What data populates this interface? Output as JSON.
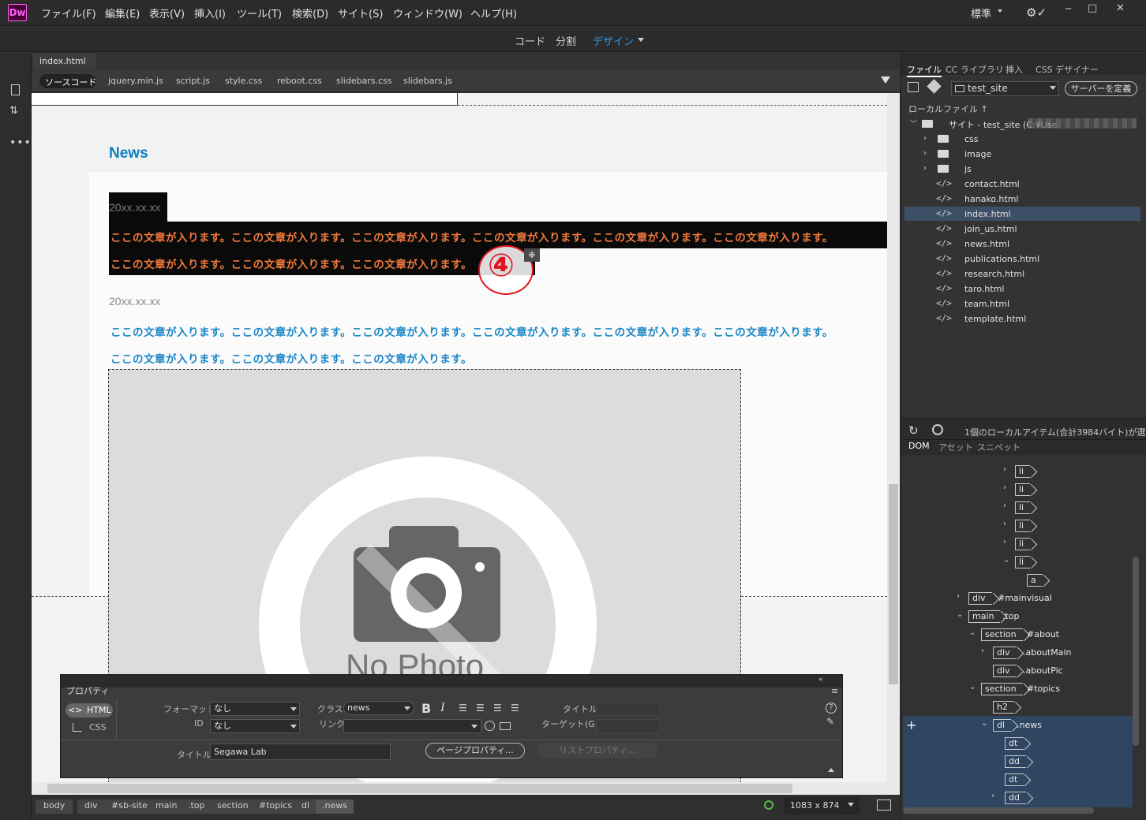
{
  "app": {
    "logo": "Dw",
    "menu": [
      "ファイル(F)",
      "編集(E)",
      "表示(V)",
      "挿入(I)",
      "ツール(T)",
      "検索(D)",
      "サイト(S)",
      "ウィンドウ(W)",
      "ヘルプ(H)"
    ],
    "workspace": "標準",
    "workspace_icon": "chevron-down-icon",
    "win_buttons": [
      "─",
      "□",
      "✕"
    ]
  },
  "views": {
    "code": "コード",
    "split": "分割",
    "design": "デザイン"
  },
  "document": {
    "tab": "index.html",
    "close": "×",
    "related": [
      "ソースコード",
      "jquery.min.js",
      "script.js",
      "style.css",
      "reboot.css",
      "slidebars.css",
      "slidebars.js"
    ]
  },
  "canvas": {
    "heading": "News",
    "item1_date": "20xx.xx.xx",
    "item1_line1": "ここの文章が入ります。ここの文章が入ります。ここの文章が入ります。ここの文章が入ります。ここの文章が入ります。ここの文章が入ります。",
    "item1_line2": "ここの文章が入ります。ここの文章が入ります。ここの文章が入ります。",
    "marker": "④",
    "item2_date": "20xx.xx.xx",
    "item2_line1": "ここの文章が入ります。ここの文章が入ります。ここの文章が入ります。ここの文章が入ります。ここの文章が入ります。ここの文章が入ります。",
    "item2_line2": "ここの文章が入ります。ここの文章が入ります。ここの文章が入ります。",
    "image_text": "No Photo"
  },
  "status": {
    "breadcrumbs": [
      "body",
      "div",
      "#sb-site",
      "main",
      ".top",
      "section",
      "#topics",
      "dl",
      ".news"
    ],
    "size": "1083 x 874"
  },
  "files_panel": {
    "tabs": [
      "ファイル",
      "CC ライブラリ",
      "挿入",
      "CSS デザイナー"
    ],
    "site_select": "test_site",
    "define_server": "サーバーを定義",
    "local_label": "ローカルファイル ↑",
    "root": "サイト - test_site (C:¥Use",
    "folders": [
      "css",
      "image",
      "js"
    ],
    "files": [
      "contact.html",
      "hanako.html",
      "index.html",
      "join_us.html",
      "news.html",
      "publications.html",
      "research.html",
      "taro.html",
      "team.html",
      "template.html"
    ],
    "selected_file": "index.html",
    "status": "1個のローカルアイテム(合計3984バイト)が選..."
  },
  "dom_panel": {
    "tabs": [
      "DOM",
      "アセット",
      "スニペット"
    ],
    "nodes": [
      {
        "tag": "li",
        "label": ""
      },
      {
        "tag": "li",
        "label": ""
      },
      {
        "tag": "li",
        "label": ""
      },
      {
        "tag": "li",
        "label": ""
      },
      {
        "tag": "li",
        "label": ""
      },
      {
        "tag": "li",
        "label": ""
      },
      {
        "tag": "a",
        "label": ""
      },
      {
        "tag": "div",
        "label": "#mainvisual"
      },
      {
        "tag": "main",
        "label": ".top"
      },
      {
        "tag": "section",
        "label": "#about"
      },
      {
        "tag": "div",
        "label": ".aboutMain"
      },
      {
        "tag": "div",
        "label": ".aboutPic"
      },
      {
        "tag": "section",
        "label": "#topics"
      },
      {
        "tag": "h2",
        "label": ""
      },
      {
        "tag": "dl",
        "label": ".news"
      },
      {
        "tag": "dt",
        "label": ""
      },
      {
        "tag": "dd",
        "label": ""
      },
      {
        "tag": "dt",
        "label": ""
      },
      {
        "tag": "dd",
        "label": ""
      }
    ],
    "add": "+"
  },
  "properties": {
    "title": "プロパティ",
    "html": "HTML",
    "css": "CSS",
    "format_label": "フォーマット",
    "format_value": "なし",
    "id_label": "ID",
    "id_value": "なし",
    "class_label": "クラス",
    "class_value": "news",
    "link_label": "リンク",
    "title_label": "タイトル",
    "target_label": "ターゲット(G)",
    "page_title_label": "タイトル",
    "page_title_value": "Segawa Lab",
    "page_props": "ページプロパティ...",
    "list_props": "リストプロパティ...",
    "bold": "B",
    "italic": "I",
    "help": "?"
  }
}
